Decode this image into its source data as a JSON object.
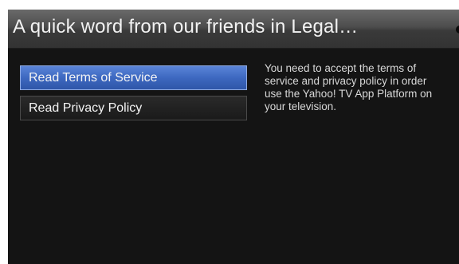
{
  "header": {
    "title": "A quick word from our friends in Legal…"
  },
  "menu": {
    "items": [
      {
        "label": "Read Terms of Service",
        "selected": true
      },
      {
        "label": "Read Privacy Policy",
        "selected": false
      }
    ]
  },
  "description": {
    "text": "You need to accept the terms of\nservice and privacy policy in order\nuse the Yahoo! TV App Platform on\nyour television."
  },
  "colors": {
    "selected_accent": "#3d68c0",
    "background": "#141414"
  }
}
